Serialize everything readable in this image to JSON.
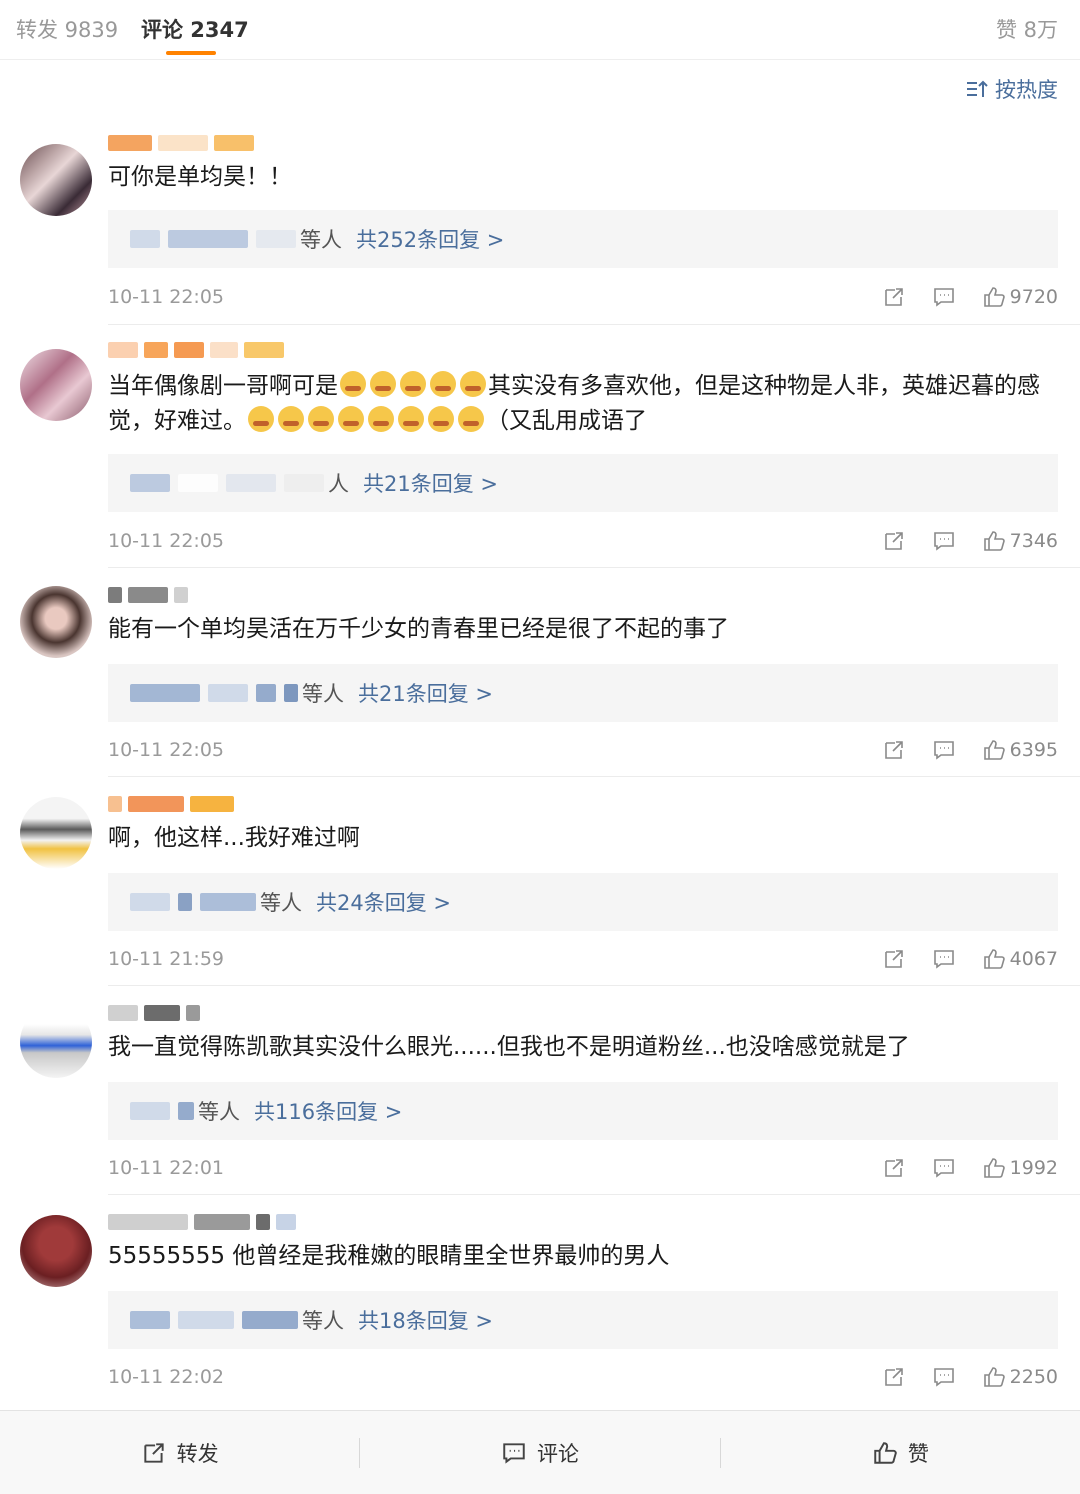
{
  "tabs": {
    "repost": "转发 9839",
    "comments": "评论 2347",
    "likes": "赞 8万"
  },
  "sort": {
    "label": "按热度",
    "icon": "sort-icon"
  },
  "comments": [
    {
      "text": "可你是单均昊！！",
      "reply_by": "等人",
      "reply_count": "共252条回复 >",
      "time": "10-11 22:05",
      "likes": "9720"
    },
    {
      "text_a": "当年偶像剧一哥啊可是",
      "text_b": "其实没有多喜欢他，但是这种物是人非，英雄迟暮的感觉，好难过。",
      "text_c": "（又乱用成语了",
      "reply_by": "人",
      "reply_count": "共21条回复 >",
      "time": "10-11 22:05",
      "likes": "7346"
    },
    {
      "text": "能有一个单均昊活在万千少女的青春里已经是很了不起的事了",
      "reply_by": "等人",
      "reply_count": "共21条回复 >",
      "time": "10-11 22:05",
      "likes": "6395"
    },
    {
      "text": "啊，他这样...我好难过啊",
      "reply_by": "等人",
      "reply_count": "共24条回复 >",
      "time": "10-11 21:59",
      "likes": "4067"
    },
    {
      "text": "我一直觉得陈凯歌其实没什么眼光......但我也不是明道粉丝...也没啥感觉就是了",
      "reply_by": "等人",
      "reply_count": "共116条回复 >",
      "time": "10-11 22:01",
      "likes": "1992"
    },
    {
      "text": "55555555 他曾经是我稚嫩的眼睛里全世界最帅的男人",
      "reply_by": "等人",
      "reply_count": "共18条回复 >",
      "time": "10-11 22:02",
      "likes": "2250"
    }
  ],
  "bottom": {
    "repost": "转发",
    "comment": "评论",
    "like": "赞"
  },
  "colors": {
    "accent": "#ff8200",
    "link": "#4a6e9c"
  }
}
